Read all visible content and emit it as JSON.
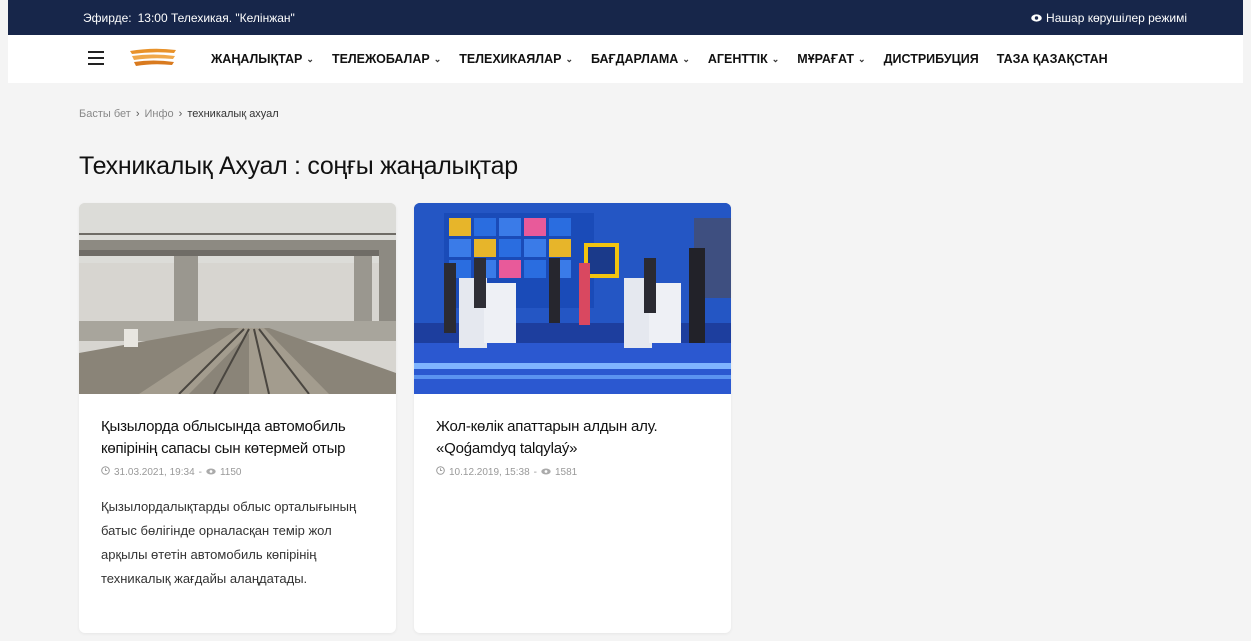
{
  "topbar": {
    "onair_label": "Эфирде:",
    "onair_program": "13:00 Телехикая. \"Келінжан\"",
    "visually_impaired_mode": "Нашар көрушілер режимі"
  },
  "nav": {
    "items": [
      {
        "label": "ЖАҢАЛЫҚТАР",
        "dropdown": true
      },
      {
        "label": "ТЕЛЕЖОБАЛАР",
        "dropdown": true
      },
      {
        "label": "ТЕЛЕХИКАЯЛАР",
        "dropdown": true
      },
      {
        "label": "БАҒДАРЛАМА",
        "dropdown": true
      },
      {
        "label": "АГЕНТТІК",
        "dropdown": true
      },
      {
        "label": "МҰРАҒАТ",
        "dropdown": true
      },
      {
        "label": "ДИСТРИБУЦИЯ",
        "dropdown": false
      },
      {
        "label": "ТАЗА ҚАЗАҚСТАН",
        "dropdown": false
      }
    ]
  },
  "breadcrumb": {
    "home": "Басты бет",
    "section": "Инфо",
    "current": "техникалық ахуал"
  },
  "page_title": "Техникалық Ахуал : соңғы жаңалықтар",
  "articles": [
    {
      "title": "Қызылорда облысында автомобиль көпірінің сапасы сын көтермей отыр",
      "date": "31.03.2021, 19:34",
      "views": "1150",
      "excerpt": "Қызылордалықтарды облыс орталығының батыс бөлігінде орналасқан темір жол арқылы өтетін автомобиль көпірінің техникалық жағдайы алаңдатады."
    },
    {
      "title": "Жол-көлік апаттарын алдын алу. «Qoǵamdyq talqylaý»",
      "date": "10.12.2019, 15:38",
      "views": "1581",
      "excerpt": ""
    }
  ],
  "icons": {
    "menu": "hamburger-icon",
    "eye": "eye-icon",
    "clock": "clock-icon",
    "views": "eye-icon",
    "chevron": "chevron-down-icon"
  },
  "colors": {
    "topbar_bg": "#17264a",
    "page_bg": "#f4f4f4"
  }
}
